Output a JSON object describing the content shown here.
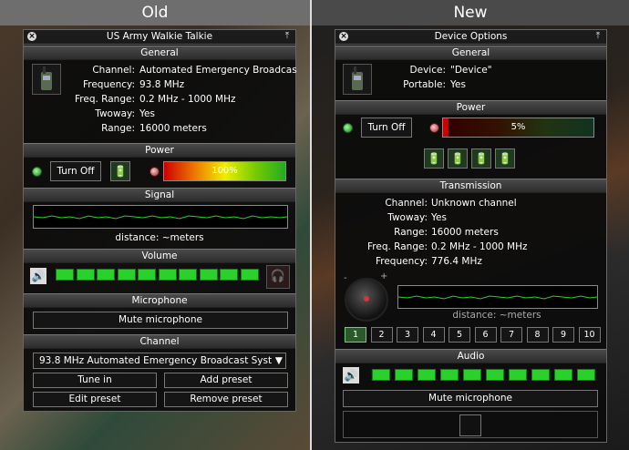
{
  "labels": {
    "old": "Old",
    "new": "New"
  },
  "left": {
    "title": "US Army Walkie Talkie",
    "general_header": "General",
    "channel_label": "Channel:",
    "channel_value": "Automated Emergency Broadcas",
    "frequency_label": "Frequency:",
    "frequency_value": "93.8 MHz",
    "range_label": "Freq. Range:",
    "range_value": "0.2 MHz - 1000 MHz",
    "twoway_label": "Twoway:",
    "twoway_value": "Yes",
    "dist_label": "Range:",
    "dist_value": "16000 meters",
    "power_header": "Power",
    "turn_off": "Turn Off",
    "power_percent": "100%",
    "power_level": 1.0,
    "signal_header": "Signal",
    "distance_text": "distance: ~meters",
    "volume_header": "Volume",
    "volume_blocks": 10,
    "mic_header": "Microphone",
    "mute_label": "Mute microphone",
    "channel_header": "Channel",
    "channel_select": "93.8 MHz Automated Emergency Broadcast Syst",
    "tune_in": "Tune in",
    "add_preset": "Add preset",
    "edit_preset": "Edit preset",
    "remove_preset": "Remove preset"
  },
  "right": {
    "title": "Device Options",
    "general_header": "General",
    "device_label": "Device:",
    "device_value": "\"Device\"",
    "portable_label": "Portable:",
    "portable_value": "Yes",
    "power_header": "Power",
    "turn_off": "Turn Off",
    "power_percent": "5%",
    "power_level": 0.05,
    "transmission_header": "Transmission",
    "channel_label": "Channel:",
    "channel_value": "Unknown channel",
    "twoway_label": "Twoway:",
    "twoway_value": "Yes",
    "dist_label": "Range:",
    "dist_value": "16000 meters",
    "range_label": "Freq. Range:",
    "range_value": "0.2 MHz - 1000 MHz",
    "frequency_label": "Frequency:",
    "frequency_value": "776.4 MHz",
    "distance_text": "distance: ~meters",
    "knob_minus": "-",
    "knob_plus": "+",
    "presets": [
      "1",
      "2",
      "3",
      "4",
      "5",
      "6",
      "7",
      "8",
      "9",
      "10"
    ],
    "audio_header": "Audio",
    "volume_blocks": 10,
    "mute_label": "Mute microphone"
  }
}
